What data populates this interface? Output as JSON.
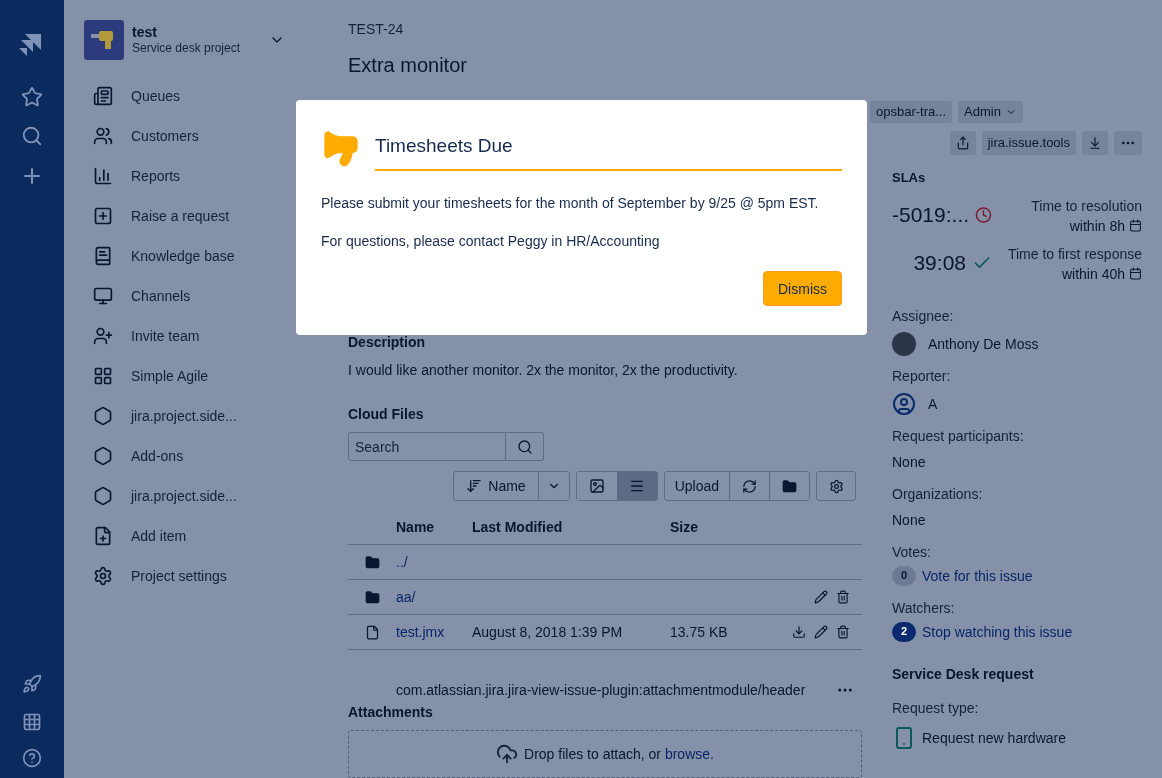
{
  "project": {
    "name": "test",
    "subtitle": "Service desk project"
  },
  "sidebar": {
    "items": [
      {
        "label": "Queues"
      },
      {
        "label": "Customers"
      },
      {
        "label": "Reports"
      },
      {
        "label": "Raise a request"
      },
      {
        "label": "Knowledge base"
      },
      {
        "label": "Channels"
      },
      {
        "label": "Invite team"
      },
      {
        "label": "Simple Agile"
      },
      {
        "label": "jira.project.side..."
      },
      {
        "label": "Add-ons"
      },
      {
        "label": "jira.project.side..."
      },
      {
        "label": "Add item"
      },
      {
        "label": "Project settings"
      }
    ]
  },
  "issue": {
    "key": "TEST-24",
    "title": "Extra monitor",
    "description_label": "Description",
    "description": "I would like another monitor. 2x the monitor, 2x the productivity."
  },
  "cloud_files": {
    "title": "Cloud Files",
    "search_placeholder": "Search",
    "sort_label": "Name",
    "view_buttons": [
      {
        "selected": false
      },
      {
        "selected": true
      }
    ],
    "upload_label": "Upload",
    "columns": [
      "Name",
      "Last Modified",
      "Size"
    ],
    "rows": [
      {
        "kind": "folder",
        "name": "../",
        "modified": "",
        "size": "",
        "actions": []
      },
      {
        "kind": "folder",
        "name": "aa/",
        "modified": "",
        "size": "",
        "actions": [
          {
            "kind": "edit"
          },
          {
            "kind": "delete"
          }
        ]
      },
      {
        "kind": "file",
        "name": "test.jmx",
        "modified": "August 8, 2018 1:39 PM",
        "size": "13.75 KB",
        "actions": [
          {
            "kind": "download"
          },
          {
            "kind": "edit"
          },
          {
            "kind": "delete"
          }
        ]
      }
    ]
  },
  "plugin_header": "com.atlassian.jira.jira-view-issue-plugin:attachmentmodule/header",
  "attachments": {
    "title": "Attachments",
    "drop_text": "Drop files to attach, or ",
    "browse_link": "browse."
  },
  "toolbar": {
    "opsbar": "opsbar-tra...",
    "admin": "Admin",
    "tools": "jira.issue.tools"
  },
  "slas": {
    "title": "SLAs",
    "items": [
      {
        "time": "-5019:...",
        "kind": "breached",
        "goal": "Time to resolution",
        "within": "within 8h"
      },
      {
        "time": "39:08",
        "kind": "met",
        "goal": "Time to first response",
        "within": "within 40h"
      }
    ]
  },
  "people": [
    {
      "label": "Assignee:",
      "value": "Anthony De Moss",
      "kind": "photo"
    },
    {
      "label": "Reporter:",
      "value": "A",
      "kind": "default"
    }
  ],
  "fields": [
    {
      "label": "Request participants:",
      "value": "None"
    },
    {
      "label": "Organizations:",
      "value": "None"
    }
  ],
  "counters": [
    {
      "label": "Votes:",
      "count": "0",
      "link": "Vote for this issue",
      "highlighted": false
    },
    {
      "label": "Watchers:",
      "count": "2",
      "link": "Stop watching this issue",
      "highlighted": true
    }
  ],
  "service_desk": {
    "title": "Service Desk request",
    "label": "Request type:",
    "value": "Request new hardware"
  },
  "modal": {
    "title": "Timesheets Due",
    "paragraphs": [
      "Please submit your timesheets for the month of September by 9/25 @ 5pm EST.",
      "For questions, please contact Peggy in HR/Accounting"
    ],
    "button": "Dismiss"
  }
}
